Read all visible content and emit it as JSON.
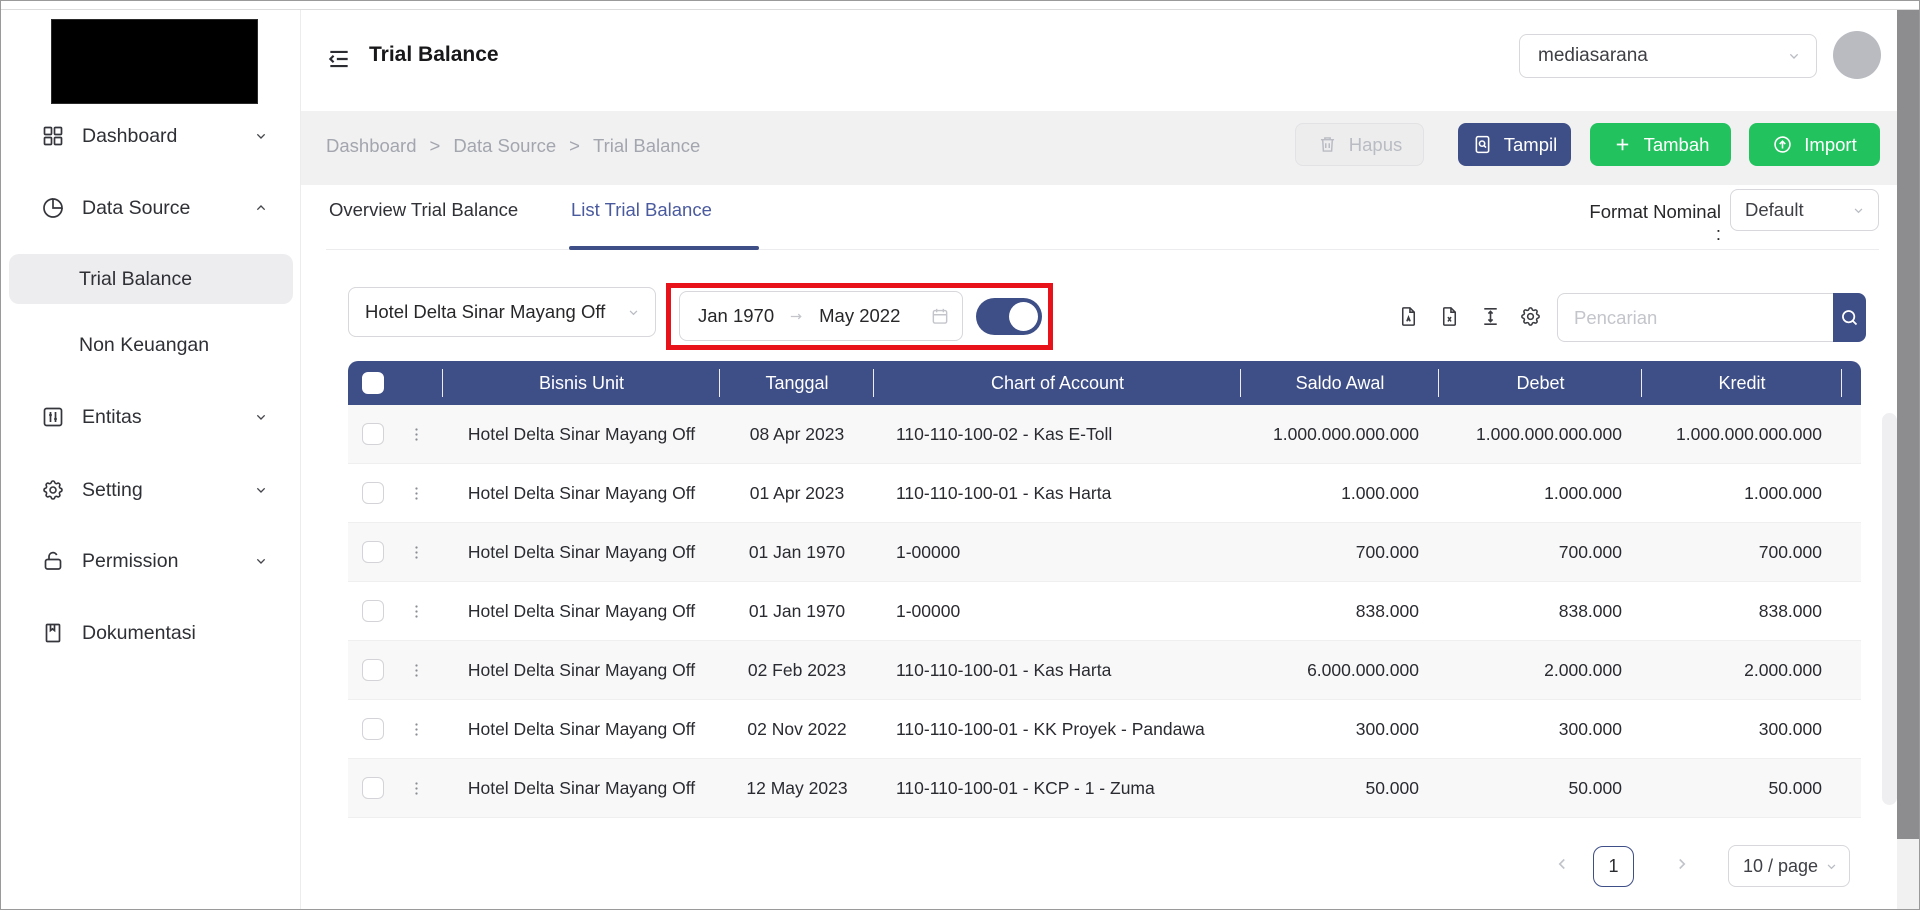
{
  "app": {
    "title": "Trial Balance",
    "workspace": "mediasarana"
  },
  "sidebar": {
    "items": [
      {
        "label": "Dashboard",
        "icon": "dashboard-grid-icon",
        "chevron": "down"
      },
      {
        "label": "Data Source",
        "icon": "pie-chart-icon",
        "chevron": "up"
      },
      {
        "label": "Trial Balance",
        "active": true
      },
      {
        "label": "Non Keuangan"
      },
      {
        "label": "Entitas",
        "icon": "entity-sliders-icon",
        "chevron": "down"
      },
      {
        "label": "Setting",
        "icon": "gear-icon",
        "chevron": "down"
      },
      {
        "label": "Permission",
        "icon": "unlock-icon",
        "chevron": "down"
      },
      {
        "label": "Dokumentasi",
        "icon": "document-icon"
      }
    ]
  },
  "breadcrumb": {
    "items": [
      "Dashboard",
      "Data Source",
      "Trial Balance"
    ],
    "separator": ">"
  },
  "actions": {
    "hapus": {
      "label": "Hapus",
      "icon": "trash-icon",
      "disabled": true
    },
    "tampil": {
      "label": "Tampil",
      "icon": "file-search-icon"
    },
    "tambah": {
      "label": "Tambah",
      "icon": "plus-icon"
    },
    "import": {
      "label": "Import",
      "icon": "upload-circle-icon"
    }
  },
  "tabs": {
    "overview": "Overview Trial Balance",
    "list": "List Trial Balance",
    "active": "list"
  },
  "format_nominal": {
    "label": "Format Nominal :",
    "value": "Default"
  },
  "filters": {
    "business_unit": "Hotel Delta Sinar Mayang Off",
    "date_from": "Jan 1970",
    "date_to": "May 2022",
    "toggle_on": true,
    "export_icons": [
      "file-pdf-icon",
      "file-excel-icon",
      "column-height-icon",
      "settings-icon"
    ],
    "search_placeholder": "Pencarian"
  },
  "table": {
    "columns": [
      "Bisnis Unit",
      "Tanggal",
      "Chart of Account",
      "Saldo Awal",
      "Debet",
      "Kredit"
    ],
    "rows": [
      {
        "unit": "Hotel Delta Sinar Mayang Off",
        "tanggal": "08 Apr 2023",
        "coa": "110-110-100-02 - Kas E-Toll",
        "saldo_awal": "1.000.000.000.000",
        "debet": "1.000.000.000.000",
        "kredit": "1.000.000.000.000"
      },
      {
        "unit": "Hotel Delta Sinar Mayang Off",
        "tanggal": "01 Apr 2023",
        "coa": "110-110-100-01 - Kas Harta",
        "saldo_awal": "1.000.000",
        "debet": "1.000.000",
        "kredit": "1.000.000"
      },
      {
        "unit": "Hotel Delta Sinar Mayang Off",
        "tanggal": "01 Jan 1970",
        "coa": "1-00000",
        "saldo_awal": "700.000",
        "debet": "700.000",
        "kredit": "700.000"
      },
      {
        "unit": "Hotel Delta Sinar Mayang Off",
        "tanggal": "01 Jan 1970",
        "coa": "1-00000",
        "saldo_awal": "838.000",
        "debet": "838.000",
        "kredit": "838.000"
      },
      {
        "unit": "Hotel Delta Sinar Mayang Off",
        "tanggal": "02 Feb 2023",
        "coa": "110-110-100-01 - Kas Harta",
        "saldo_awal": "6.000.000.000",
        "debet": "2.000.000",
        "kredit": "2.000.000"
      },
      {
        "unit": "Hotel Delta Sinar Mayang Off",
        "tanggal": "02 Nov 2022",
        "coa": "110-110-100-01 - KK Proyek - Pandawa",
        "saldo_awal": "300.000",
        "debet": "300.000",
        "kredit": "300.000"
      },
      {
        "unit": "Hotel Delta Sinar Mayang Off",
        "tanggal": "12 May 2023",
        "coa": "110-110-100-01 - KCP - 1 - Zuma",
        "saldo_awal": "50.000",
        "debet": "50.000",
        "kredit": "50.000"
      }
    ]
  },
  "pagination": {
    "current_page": "1",
    "page_size": "10 / page"
  },
  "colors": {
    "accent_indigo": "#3E4E87",
    "accent_green": "#22C35E",
    "annotation_red": "#E8121A",
    "active_tab_text": "#4A5A9E",
    "table_header_bg": "#3E4E87"
  }
}
